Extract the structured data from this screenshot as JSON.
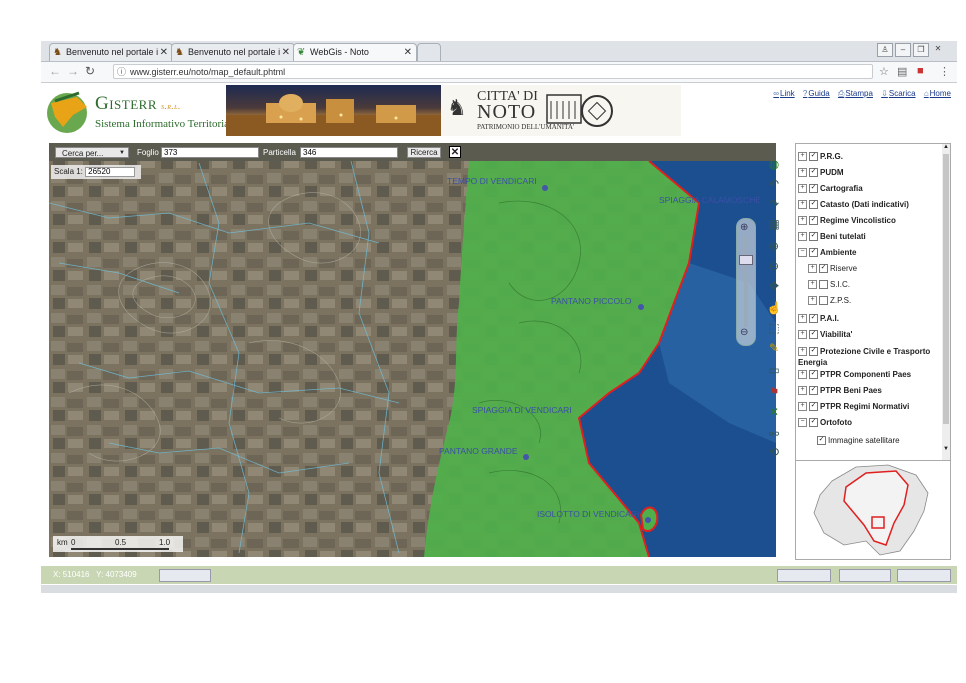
{
  "browser": {
    "tabs": [
      {
        "label": "Benvenuto nel portale i"
      },
      {
        "label": "Benvenuto nel portale i"
      },
      {
        "label": "WebGis - Noto"
      }
    ],
    "url": "www.gisterr.eu/noto/map_default.phtml"
  },
  "header": {
    "logo_name": "Gisterr",
    "logo_suffix": "s.r.l.",
    "logo_subtitle": "Sistema Informativo Territoriale",
    "city_line1": "CITTA' DI",
    "city_line2": "NOTO",
    "city_line3": "PATRIMONIO DELL'UMANITA'",
    "links": [
      {
        "label": "Link",
        "icon": "link-icon"
      },
      {
        "label": "Guida",
        "icon": "help-icon"
      },
      {
        "label": "Stampa",
        "icon": "print-icon"
      },
      {
        "label": "Scarica",
        "icon": "download-icon"
      },
      {
        "label": "Home",
        "icon": "home-icon"
      }
    ]
  },
  "search": {
    "select_value": "Cerca per...",
    "foglio_label": "Foglio",
    "foglio_value": "373",
    "particella_label": "Particella",
    "particella_value": "346",
    "button": "Ricerca",
    "close": "✕"
  },
  "scale": {
    "label": "Scala 1:",
    "value": "26520"
  },
  "map_labels": [
    {
      "text": "TEMPO DI VENDICARI"
    },
    {
      "text": "SPIAGGIA CALAMOSCHE"
    },
    {
      "text": "PANTANO PICCOLO"
    },
    {
      "text": "SPIAGGIA DI VENDICARI"
    },
    {
      "text": "PANTANO GRANDE"
    },
    {
      "text": "ISOLOTTO DI VENDICARI"
    }
  ],
  "scalebar": {
    "unit": "km",
    "ticks": [
      "0",
      "0.5",
      "1.0"
    ]
  },
  "layers": [
    {
      "label": "P.R.G.",
      "level": 0,
      "expander": "+",
      "checked": true
    },
    {
      "label": "PUDM",
      "level": 0,
      "expander": "+",
      "checked": true
    },
    {
      "label": "Cartografia",
      "level": 0,
      "expander": "+",
      "checked": true
    },
    {
      "label": "Catasto (Dati indicativi)",
      "level": 0,
      "expander": "+",
      "checked": true
    },
    {
      "label": "Regime Vincolistico",
      "level": 0,
      "expander": "+",
      "checked": true
    },
    {
      "label": "Beni tutelati",
      "level": 0,
      "expander": "+",
      "checked": true
    },
    {
      "label": "Ambiente",
      "level": 0,
      "expander": "−",
      "checked": true
    },
    {
      "label": "Riserve",
      "level": 1,
      "expander": "+",
      "checked": true
    },
    {
      "label": "S.I.C.",
      "level": 1,
      "expander": "+",
      "checked": false
    },
    {
      "label": "Z.P.S.",
      "level": 1,
      "expander": "+",
      "checked": false
    },
    {
      "label": "P.A.I.",
      "level": 0,
      "expander": "+",
      "checked": true
    },
    {
      "label": "Viabilita'",
      "level": 0,
      "expander": "+",
      "checked": true
    },
    {
      "label": "Protezione Civile e Trasporto Energia",
      "level": 0,
      "expander": "+",
      "checked": true
    },
    {
      "label": "PTPR Componenti Paes",
      "level": 0,
      "expander": "+",
      "checked": true
    },
    {
      "label": "PTPR Beni Paes",
      "level": 0,
      "expander": "+",
      "checked": true
    },
    {
      "label": "PTPR Regimi Normativi",
      "level": 0,
      "expander": "+",
      "checked": true
    },
    {
      "label": "Ortofoto",
      "level": 0,
      "expander": "−",
      "checked": true
    },
    {
      "label": "Immagine satellitare",
      "level": 1,
      "expander": "",
      "checked": true
    }
  ],
  "status": {
    "x_label": "X:",
    "x_value": "510416",
    "y_label": "Y:",
    "y_value": "4073409"
  },
  "colors": {
    "reserve_green": "#4fb04a",
    "sea_blue": "#1c4f8f",
    "boundary_red": "#e02020",
    "label_blue": "#3b4fa8"
  }
}
